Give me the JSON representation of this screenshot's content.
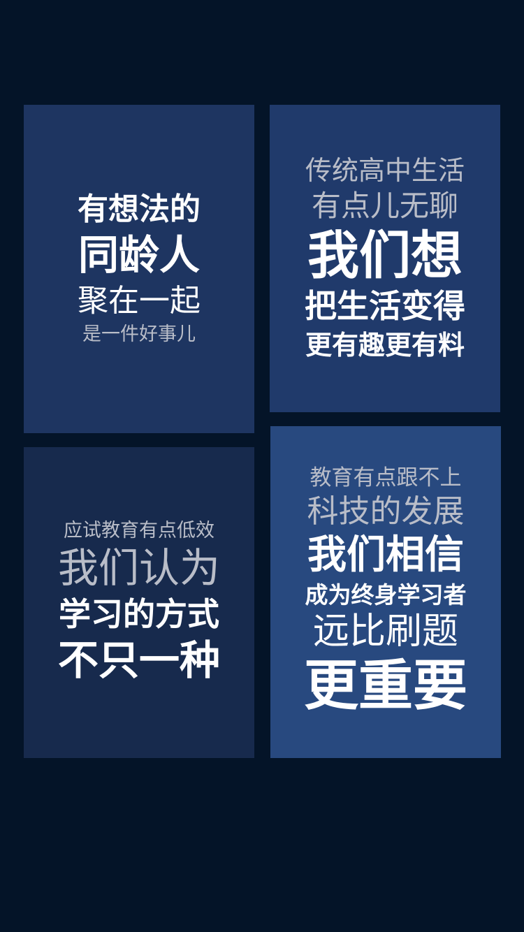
{
  "cards": [
    {
      "lines": [
        "有想法的",
        "同龄人",
        "聚在一起",
        "是一件好事儿"
      ]
    },
    {
      "lines": [
        "传统高中生活",
        "有点儿无聊",
        "我们想",
        "把生活变得",
        "更有趣更有料"
      ]
    },
    {
      "lines": [
        "应试教育有点低效",
        "我们认为",
        "学习的方式",
        "不只一种"
      ]
    },
    {
      "lines": [
        "教育有点跟不上",
        "科技的发展",
        "我们相信",
        "成为终身学习者",
        "远比刷题",
        "更重要"
      ]
    }
  ],
  "colors": {
    "background": "#041428",
    "card_1": "#1e3561",
    "card_2": "#203a6b",
    "card_3": "#172a4d",
    "card_4": "#28497f",
    "text_white": "#ffffff",
    "text_gray": "#b9bdc8"
  }
}
